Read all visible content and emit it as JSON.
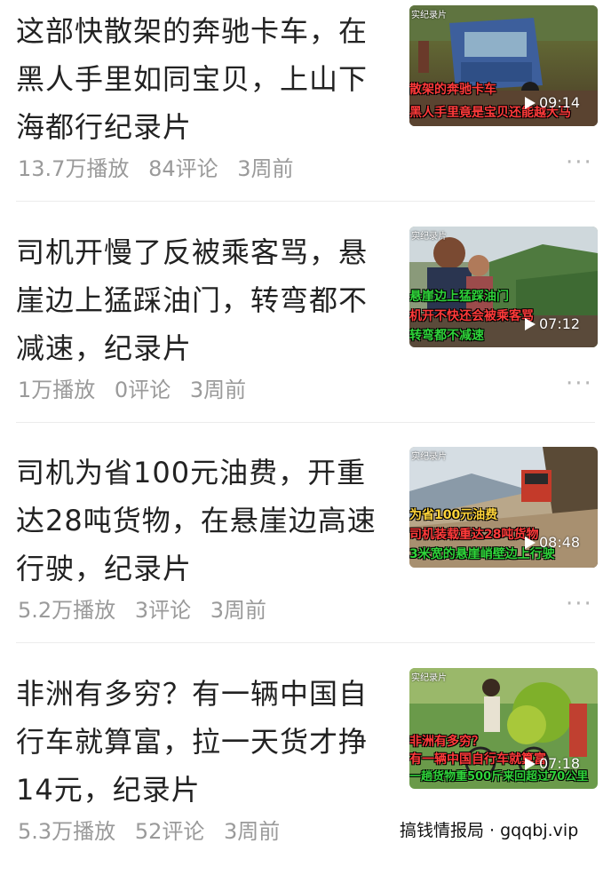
{
  "feed": {
    "items": [
      {
        "title": "这部快散架的奔驰卡车，在黑人手里如同宝贝，上山下海都行纪录片",
        "views": "13.7万播放",
        "comments": "84评论",
        "time": "3周前",
        "more": "···",
        "thumb": {
          "tag": "实纪录片",
          "cap1": "散架的奔驰卡车",
          "cap2": "黑人手里竟是宝贝还能越大马",
          "cap3": "",
          "duration": "09:14"
        }
      },
      {
        "title": "司机开慢了反被乘客骂，悬崖边上猛踩油门，转弯都不减速，纪录片",
        "views": "1万播放",
        "comments": "0评论",
        "time": "3周前",
        "more": "···",
        "thumb": {
          "tag": "实纪录片",
          "cap1": "悬崖边上猛踩油门",
          "cap2": "机开不快还会被乘客骂",
          "cap3": "转弯都不减速",
          "duration": "07:12"
        }
      },
      {
        "title": "司机为省100元油费，开重达28吨货物，在悬崖边高速行驶，纪录片",
        "views": "5.2万播放",
        "comments": "3评论",
        "time": "3周前",
        "more": "···",
        "thumb": {
          "tag": "实纪录片",
          "cap1": "为省100元油费",
          "cap2": "司机装载重达28吨货物",
          "cap3": "3米宽的悬崖峭壁边上行驶",
          "duration": "08:48"
        }
      },
      {
        "title": "非洲有多穷？有一辆中国自行车就算富，拉一天货才挣14元，纪录片",
        "views": "5.3万播放",
        "comments": "52评论",
        "time": "3周前",
        "more": "···",
        "thumb": {
          "tag": "实纪录片",
          "cap1": "非洲有多穷？",
          "cap2": "有一辆中国自行车就算富",
          "cap3": "一趟货物重500斤来回超过70公里",
          "duration": "07:18"
        }
      }
    ]
  },
  "watermark": "搞钱情报局 · gqqbj.vip",
  "colors": {
    "title": "#222222",
    "meta": "#9a9a9a",
    "caption_red": "#ff3a3a",
    "caption_green": "#2fd43a",
    "divider": "#ececec"
  },
  "icons": [
    "play-icon",
    "more-icon"
  ]
}
